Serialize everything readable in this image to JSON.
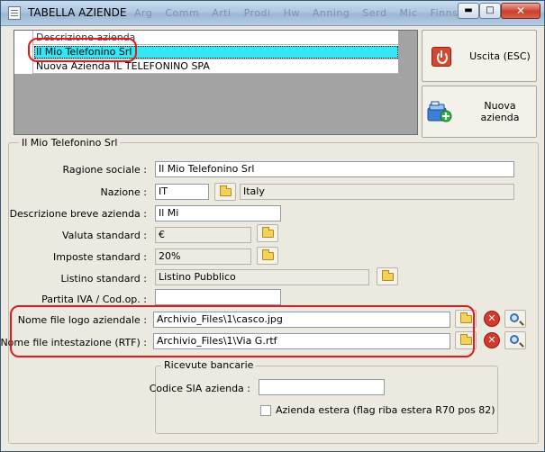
{
  "window": {
    "title": "TABELLA AZIENDE",
    "ghost_menu": [
      "Arg",
      "Comm",
      "Arti",
      "Prodi",
      "Hw",
      "Anning",
      "Serd",
      "Mic",
      "Finns"
    ]
  },
  "icons": {
    "app": "table-icon",
    "minimize": "minimize-icon",
    "maximize": "maximize-icon",
    "close": "close-icon",
    "exit": "power-icon",
    "new_company": "new-company-icon",
    "folder": "folder-icon",
    "delete": "delete-icon",
    "search": "magnifier-icon"
  },
  "grid": {
    "header": "Descrizione azienda",
    "rows": [
      "Il Mio Telefonino Srl",
      "Nuova Azienda IL TELEFONINO SPA"
    ],
    "selected_index": 0
  },
  "buttons": {
    "exit": "Uscita (ESC)",
    "new_company": "Nuova azienda"
  },
  "group_title": "Il Mio Telefonino Srl",
  "form": {
    "ragione_sociale": {
      "label": "Ragione sociale :",
      "value": "Il Mio Telefonino Srl"
    },
    "nazione": {
      "label": "Nazione :",
      "code": "IT",
      "name": "Italy"
    },
    "descrizione_breve": {
      "label": "Descrizione breve azienda :",
      "value": "Il Mi"
    },
    "valuta": {
      "label": "Valuta standard :",
      "value": "€"
    },
    "imposte": {
      "label": "Imposte standard :",
      "value": "20%"
    },
    "listino": {
      "label": "Listino standard :",
      "value": "Listino Pubblico"
    },
    "partita_iva": {
      "label": "Partita IVA / Cod.op. :",
      "value": ""
    },
    "logo_file": {
      "label": "Nome file logo aziendale :",
      "value": "Archivio_Files\\1\\casco.jpg"
    },
    "header_file": {
      "label": "Nome file intestazione (RTF) :",
      "value": "Archivio_Files\\1\\Via G.rtf"
    }
  },
  "ricevute": {
    "title": "Ricevute bancarie",
    "codice_sia": {
      "label": "Codice SIA azienda :",
      "value": ""
    },
    "azienda_estera": {
      "label": "Azienda estera (flag riba estera R70 pos 82)",
      "checked": false
    }
  },
  "colors": {
    "selection": "#35e6f5",
    "highlight": "#e01b1b",
    "titlebar": "#aec6e0",
    "window_bg": "#eceae0"
  }
}
